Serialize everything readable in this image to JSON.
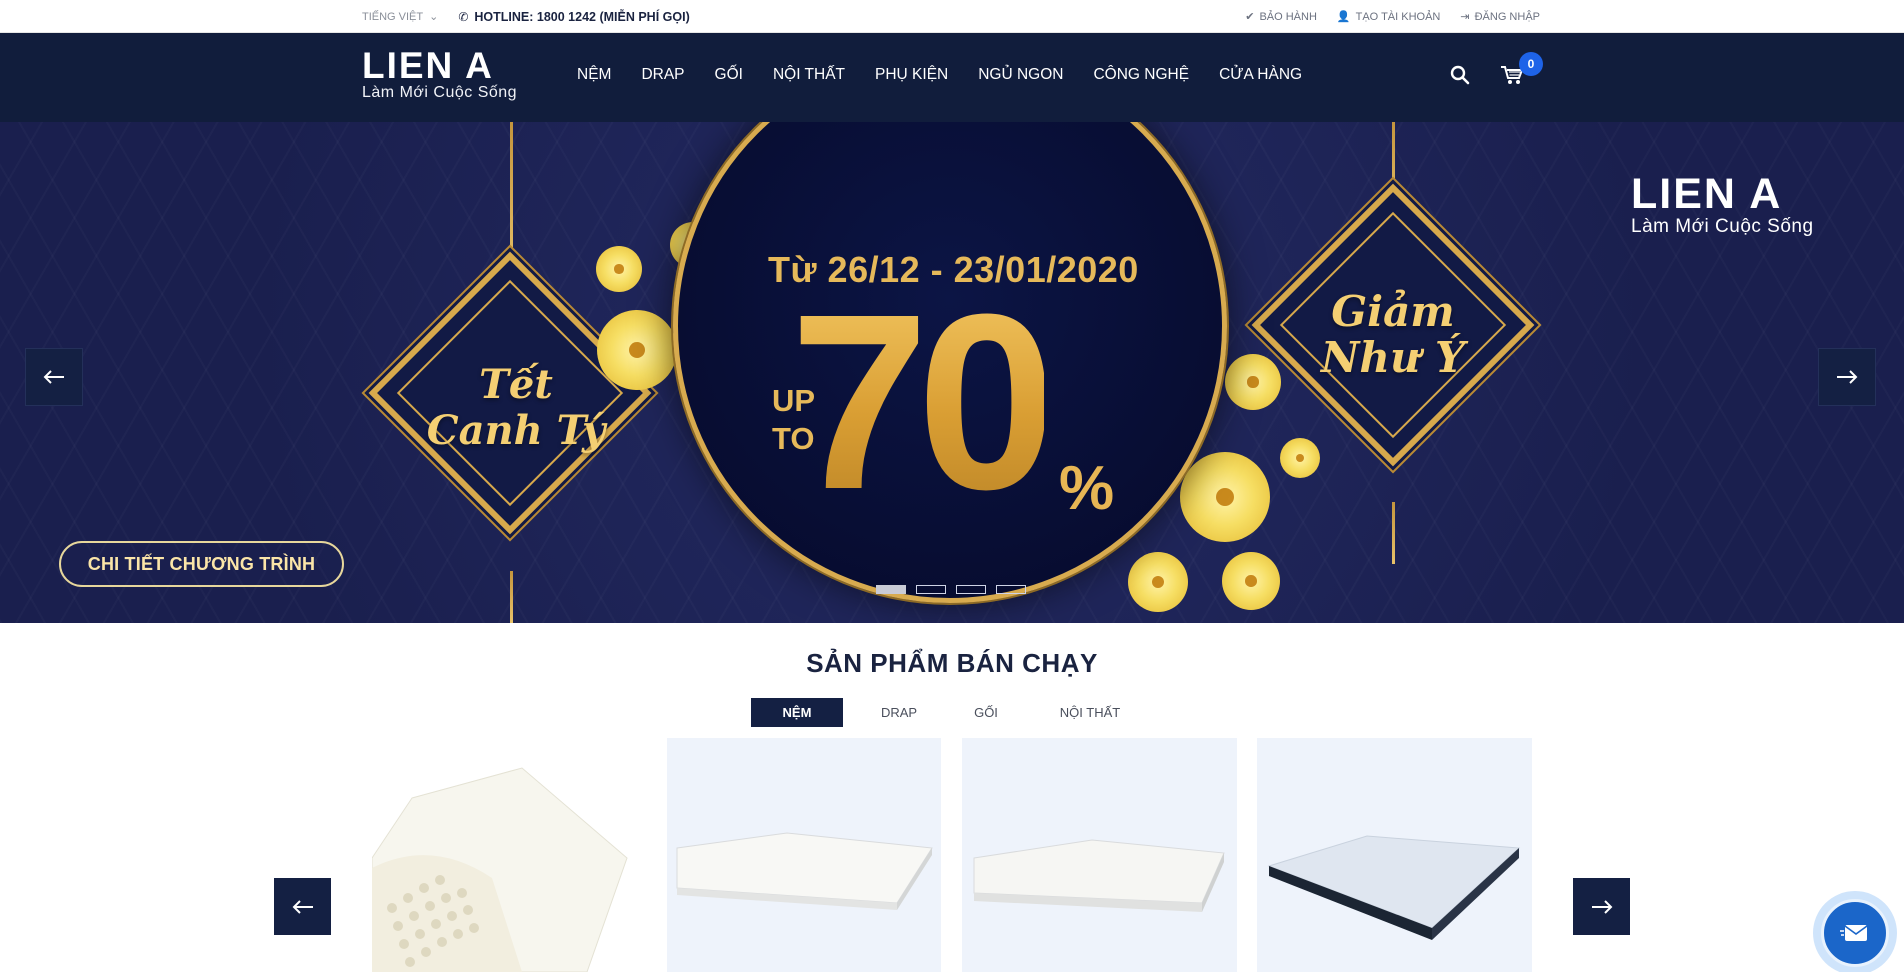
{
  "topbar": {
    "language": "TIẾNG VIỆT",
    "hotline": "HOTLINE: 1800 1242 (MIỄN PHÍ GỌI)",
    "links": [
      {
        "label": "BẢO HÀNH",
        "icon": "check-circle-icon"
      },
      {
        "label": "TẠO TÀI KHOẢN",
        "icon": "user-icon"
      },
      {
        "label": "ĐĂNG NHẬP",
        "icon": "sign-in-icon"
      }
    ]
  },
  "header": {
    "brand": "LIEN A",
    "tagline": "Làm Mới Cuộc Sống",
    "nav": [
      "NỆM",
      "DRAP",
      "GỐI",
      "NỘI THẤT",
      "PHỤ KIỆN",
      "NGỦ NGON",
      "CÔNG NGHỆ",
      "CỬA HÀNG"
    ],
    "cart_count": "0"
  },
  "hero": {
    "left_ornament": [
      "Tết",
      "Canh Tý"
    ],
    "right_ornament": [
      "Giảm",
      "Như Ý"
    ],
    "date_range": "Từ 26/12 - 23/01/2020",
    "upto": [
      "UP",
      "TO"
    ],
    "discount_number": "70",
    "discount_unit": "%",
    "brand": "LIEN A",
    "tagline": "Làm Mới Cuộc Sống",
    "cta": "CHI TIẾT CHƯƠNG TRÌNH",
    "slides_total": 4,
    "active_slide": 1
  },
  "best_sellers": {
    "title": "SẢN PHẨM BÁN CHẠY",
    "tabs": [
      "NỆM",
      "DRAP",
      "GỐI",
      "NỘI THẤT"
    ],
    "active_tab": "NỆM"
  },
  "colors": {
    "navy": "#111d3c",
    "gold": "#d8ab4f",
    "badge_blue": "#1e63e8"
  }
}
